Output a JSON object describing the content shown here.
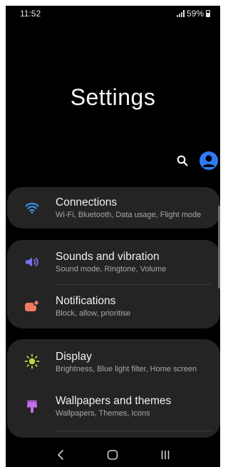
{
  "status_bar": {
    "time": "11:52",
    "battery_text": "59%"
  },
  "page_title": "Settings",
  "colors": {
    "background": "#000000",
    "card": "#242424",
    "accent_blue": "#2f7bf6",
    "connections_icon": "#3b9cf6",
    "sounds_icon": "#7b72f0",
    "notifications_icon": "#f07a62",
    "display_icon": "#b5d93a",
    "wallpapers_icon": "#c56ff0"
  },
  "header_actions": {
    "search_icon": "search-icon",
    "profile_icon": "account-avatar-icon"
  },
  "settings": [
    {
      "title": "Connections",
      "subtitle": "Wi-Fi, Bluetooth, Data usage, Flight mode",
      "icon": "wifi-icon"
    },
    {
      "title": "Sounds and vibration",
      "subtitle": "Sound mode, Ringtone, Volume",
      "icon": "volume-icon"
    },
    {
      "title": "Notifications",
      "subtitle": "Block, allow, prioritise",
      "icon": "notification-icon"
    },
    {
      "title": "Display",
      "subtitle": "Brightness, Blue light filter, Home screen",
      "icon": "brightness-icon"
    },
    {
      "title": "Wallpapers and themes",
      "subtitle": "Wallpapers, Themes, Icons",
      "icon": "paint-brush-icon"
    }
  ],
  "nav_bar": {
    "back": "back-icon",
    "home": "home-icon",
    "recents": "recents-icon"
  }
}
